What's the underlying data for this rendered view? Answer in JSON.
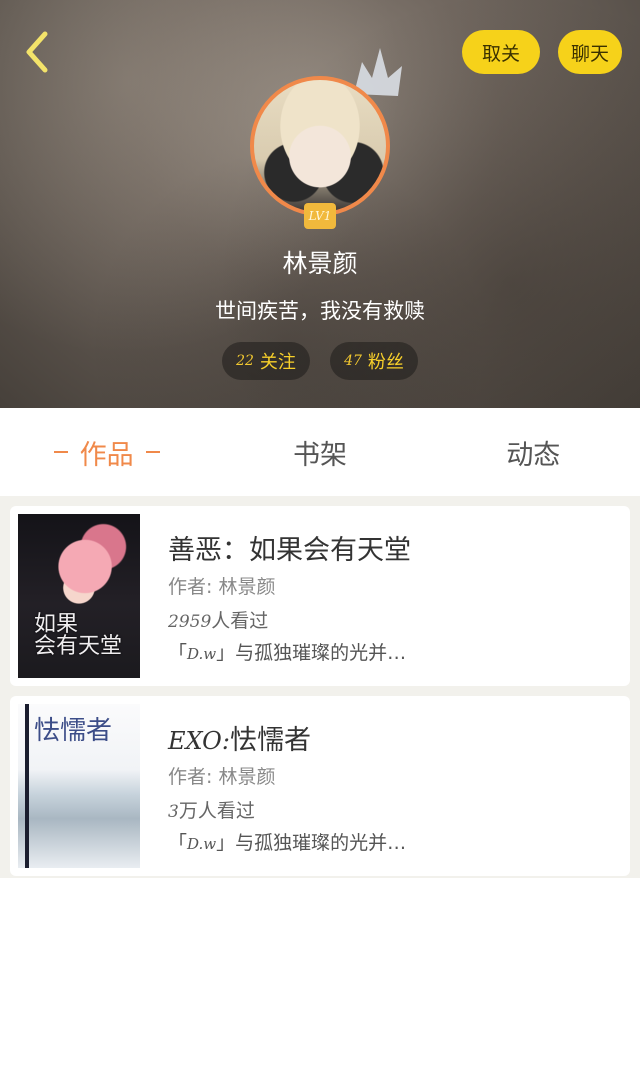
{
  "header": {
    "unfollow_label": "取关",
    "chat_label": "聊天",
    "level": "LV1",
    "nickname": "林景颜",
    "signature": "世间疾苦，我没有救赎",
    "following_count": "22",
    "following_label": "关注",
    "fans_count": "47",
    "fans_label": "粉丝",
    "accent_color": "#f6d21a",
    "avatar_ring_color": "#f0894a"
  },
  "tabs": [
    {
      "label": "作品",
      "active": true
    },
    {
      "label": "书架",
      "active": false
    },
    {
      "label": "动态",
      "active": false
    }
  ],
  "works": [
    {
      "title": "善恶：如果会有天堂",
      "title_prefix": "",
      "author": "作者: 林景颜",
      "views_count": "2959",
      "views_suffix": "人看过",
      "desc_prefix": "「",
      "desc_tag": "D.w",
      "desc_rest": "」与孤独璀璨的光并…",
      "cover_text": "如果\n会有天堂"
    },
    {
      "title": "怯懦者",
      "title_prefix": "EXO:",
      "author": "作者: 林景颜",
      "views_count": "3",
      "views_suffix": "万人看过",
      "desc_prefix": "「",
      "desc_tag": "D.w",
      "desc_rest": "」与孤独璀璨的光并…",
      "cover_text": "怯懦者"
    }
  ]
}
